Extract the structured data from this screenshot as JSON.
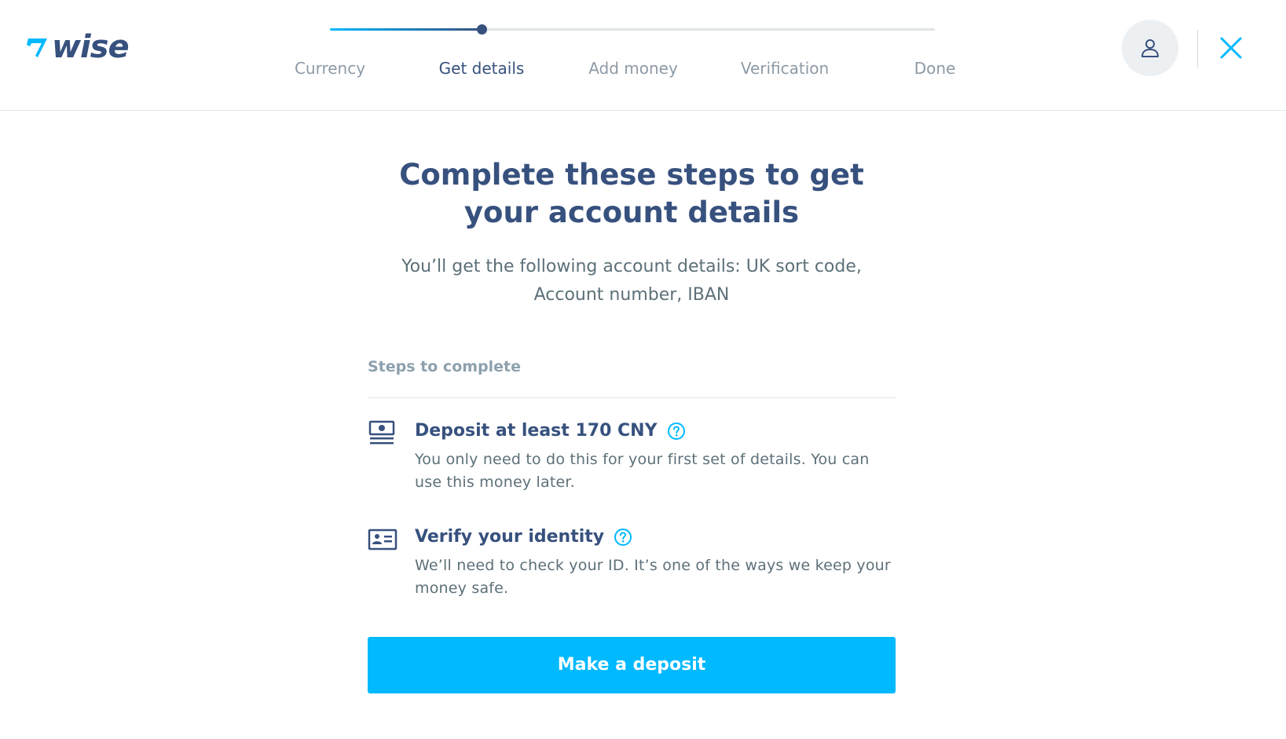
{
  "brand": {
    "logo_text": "wise",
    "accent": "#00b9ff",
    "navy": "#37517e"
  },
  "stepper": {
    "steps": [
      {
        "label": "Currency"
      },
      {
        "label": "Get details"
      },
      {
        "label": "Add money"
      },
      {
        "label": "Verification"
      },
      {
        "label": "Done"
      }
    ],
    "active_index": 1
  },
  "header": {
    "avatar_icon": "user-icon",
    "close_icon": "close-icon"
  },
  "main": {
    "title": "Complete these steps to get your account details",
    "subtitle": "You’ll get the following account details: UK sort code, Account number, IBAN",
    "steps_heading": "Steps to complete",
    "items": [
      {
        "icon": "cash-stack-icon",
        "title": "Deposit at least 170 CNY",
        "description": "You only need to do this for your first set of details. You can use this money later."
      },
      {
        "icon": "id-card-icon",
        "title": "Verify your identity",
        "description": "We’ll need to check your ID. It’s one of the ways we keep your money safe."
      }
    ],
    "cta_label": "Make a deposit"
  }
}
